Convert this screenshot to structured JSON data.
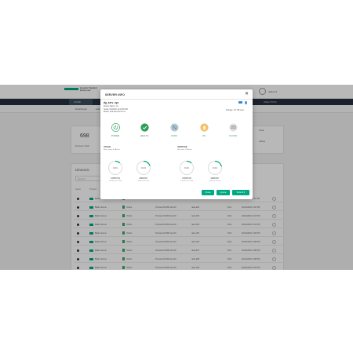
{
  "brand": {
    "name": "Hewlett Packard Enterprise",
    "color": "#01a982"
  },
  "user": {
    "name": "Admin ▾"
  },
  "nav": {
    "items": [
      "HOME",
      "DEVICES",
      "ANALYTICS"
    ]
  },
  "subnav": {
    "items": [
      "Dashboard",
      "Add",
      "Refresh"
    ]
  },
  "stats": {
    "count": "698",
    "count_label": "Devices Total",
    "side1": "Total",
    "side2": "Active"
  },
  "table": {
    "title": "DEVICES",
    "search_placeholder": "Search",
    "columns": [
      "Name",
      "Product",
      "Status",
      "Model",
      "Location",
      "Site",
      "Updated"
    ],
    "rows": [
      {
        "product": "Blade Server",
        "status": "Online",
        "model": "ProLiant DL380 Gen10",
        "location": "rack-a01",
        "site": "DC1",
        "updated": "02/14/2022 2:11 PM"
      },
      {
        "product": "Blade Server",
        "status": "Online",
        "model": "ProLiant DL360 Gen10",
        "location": "rack-a02",
        "site": "DC1",
        "updated": "02/14/2022 2:11 PM"
      },
      {
        "product": "Blade Server",
        "status": "Online",
        "model": "ProLiant DL380 Gen10",
        "location": "rack-b03",
        "site": "DC2",
        "updated": "02/14/2022 2:10 PM"
      },
      {
        "product": "Blade Server",
        "status": "Online",
        "model": "ProLiant DL360 Gen10",
        "location": "rack-b04",
        "site": "DC2",
        "updated": "02/14/2022 2:10 PM"
      },
      {
        "product": "Blade Server",
        "status": "Online",
        "model": "ProLiant DL380 Gen10",
        "location": "rack-c05",
        "site": "DC3",
        "updated": "02/14/2022 2:09 PM"
      },
      {
        "product": "Blade Server",
        "status": "Online",
        "model": "ProLiant DL360 Gen10",
        "location": "rack-c06",
        "site": "DC3",
        "updated": "02/14/2022 2:09 PM"
      },
      {
        "product": "Blade Server",
        "status": "Online",
        "model": "ProLiant DL380 Gen10",
        "location": "rack-d07",
        "site": "DC1",
        "updated": "02/14/2022 2:08 PM"
      },
      {
        "product": "Blade Server",
        "status": "Online",
        "model": "ProLiant DL360 Gen10",
        "location": "rack-d08",
        "site": "DC2",
        "updated": "02/14/2022 2:08 PM"
      },
      {
        "product": "Blade Server",
        "status": "Online",
        "model": "ProLiant DL380 Gen10",
        "location": "rack-e09",
        "site": "DC3",
        "updated": "02/14/2022 2:07 PM"
      }
    ]
  },
  "modal": {
    "title": "SERVER INFO",
    "name": "dg_serv_xyz",
    "meta": [
      "Device Name: srv",
      "Serial: 5/4/2022 11:24:59 PM",
      "Model: ProLiant Gen10 v2"
    ],
    "storage": "Storage: 2.0 TB used",
    "statuses": [
      {
        "label": "POWER",
        "icon": "power-icon",
        "color": "#3aa76d"
      },
      {
        "label": "HEALTH",
        "icon": "check-icon",
        "color": "#2e9e5a"
      },
      {
        "label": "FANS",
        "icon": "fan-icon",
        "color": "#9fb8c8"
      },
      {
        "label": "OS",
        "icon": "os-icon",
        "color": "#f0b44a"
      },
      {
        "label": "CLOUD",
        "icon": "cloud-icon",
        "color": "#dcdcdc"
      }
    ],
    "section1": {
      "title": "USAGE",
      "sub": "Max usage: 80 Active"
    },
    "section2": {
      "title": "AVERAGE",
      "sub": "Max time: 62 Active"
    },
    "gauges": [
      {
        "value": "0.01",
        "label": "COMPUTE",
        "sub": "0.3 Max of 12 Total",
        "fraction": 0.12
      },
      {
        "value": "0.01",
        "label": "MEMORY",
        "sub": "0 Max of 12 Total",
        "fraction": 0.2
      },
      {
        "value": "0.01",
        "label": "COMPUTE",
        "sub": "0.3 Max of 12 Total",
        "fraction": 0.12
      },
      {
        "value": "0.01",
        "label": "MEMORY",
        "sub": "0 Max of 12 Total",
        "fraction": 0.22
      }
    ],
    "buttons": {
      "close": "Close",
      "ignore": "Ignore",
      "submit": "Submit ▾"
    }
  }
}
